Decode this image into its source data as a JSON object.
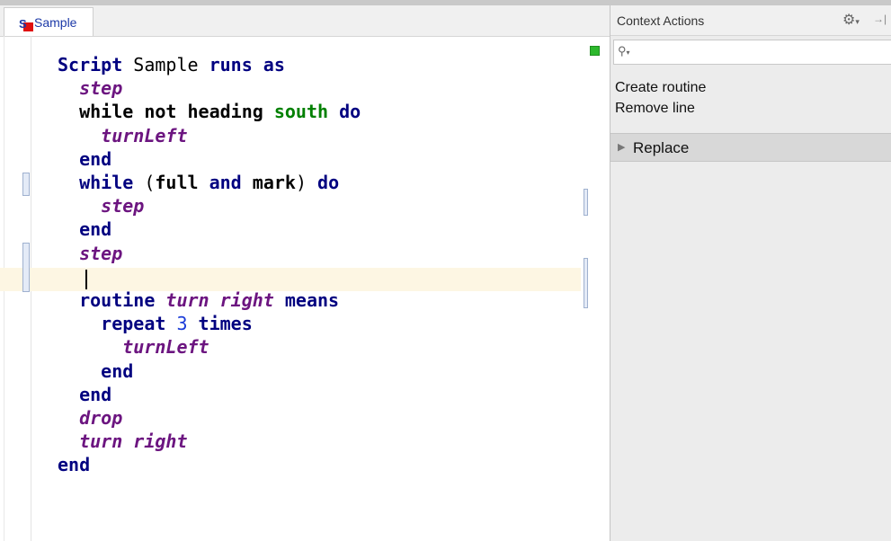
{
  "editor": {
    "tab_label": "Sample",
    "code_lines": [
      [
        {
          "t": "Script ",
          "c": "kw"
        },
        {
          "t": "Sample ",
          "c": "plain"
        },
        {
          "t": "runs as",
          "c": "kw"
        }
      ],
      [
        {
          "t": "  step",
          "c": "call"
        }
      ],
      [
        {
          "t": "  while not heading ",
          "c": "cmd"
        },
        {
          "t": "south",
          "c": "green"
        },
        {
          "t": " do",
          "c": "kw"
        }
      ],
      [
        {
          "t": "    turnLeft",
          "c": "call"
        }
      ],
      [
        {
          "t": "  end",
          "c": "kw"
        }
      ],
      [
        {
          "t": "  while",
          "c": "kw"
        },
        {
          "t": " (",
          "c": "plain"
        },
        {
          "t": "full",
          "c": "cmd"
        },
        {
          "t": " and ",
          "c": "kw"
        },
        {
          "t": "mark",
          "c": "cmd"
        },
        {
          "t": ") ",
          "c": "plain"
        },
        {
          "t": "do",
          "c": "kw"
        }
      ],
      [
        {
          "t": "    step",
          "c": "call"
        }
      ],
      [
        {
          "t": "  end",
          "c": "kw"
        }
      ],
      [
        {
          "t": "  step",
          "c": "call"
        }
      ],
      [
        {
          "t": "",
          "c": "plain"
        }
      ],
      [
        {
          "t": "  routine ",
          "c": "kw"
        },
        {
          "t": "turn right",
          "c": "call"
        },
        {
          "t": " means",
          "c": "kw"
        }
      ],
      [
        {
          "t": "    repeat ",
          "c": "kw"
        },
        {
          "t": "3",
          "c": "num"
        },
        {
          "t": " times",
          "c": "kw"
        }
      ],
      [
        {
          "t": "      turnLeft",
          "c": "call"
        }
      ],
      [
        {
          "t": "    end",
          "c": "kw"
        }
      ],
      [
        {
          "t": "  end",
          "c": "kw"
        }
      ],
      [
        {
          "t": "  drop",
          "c": "call"
        }
      ],
      [
        {
          "t": "  turn right",
          "c": "call"
        }
      ],
      [
        {
          "t": "end",
          "c": "kw"
        }
      ]
    ]
  },
  "context_panel": {
    "title": "Context Actions",
    "gear_icon": "gear-icon",
    "actions": [
      "Create routine",
      "Remove line"
    ],
    "replace_label": "Replace"
  },
  "colors": {
    "keyword": "#000080",
    "routine_call": "#6c1580",
    "direction": "#008000",
    "number": "#1a3bd8",
    "caret_line": "#fdf6e3",
    "status_marker": "#2cb82c"
  }
}
